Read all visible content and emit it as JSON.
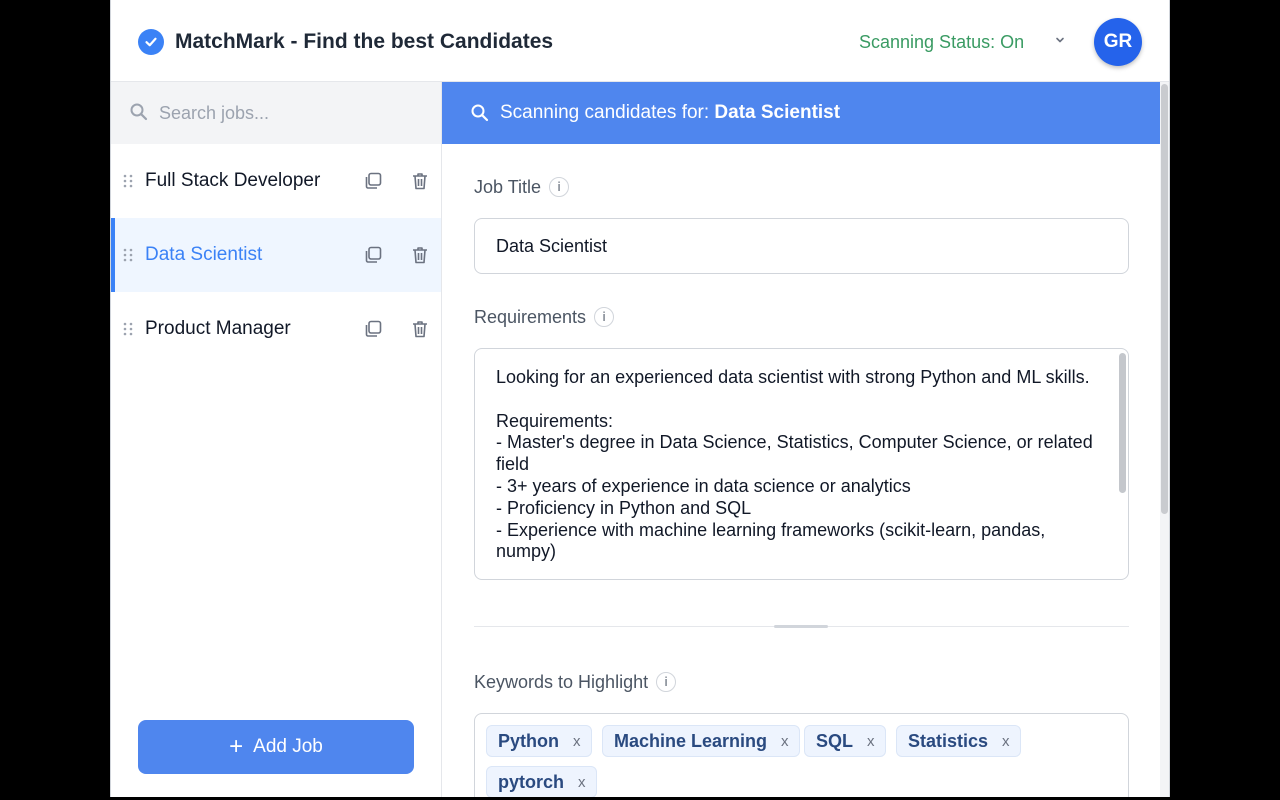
{
  "header": {
    "title": "MatchMark - Find the best Candidates",
    "status": "Scanning Status: On",
    "avatar_initials": "GR",
    "brand_color": "#3b82f6",
    "status_color": "#3a9b63"
  },
  "sidebar": {
    "search_placeholder": "Search jobs...",
    "jobs": [
      {
        "label": "Full Stack Developer",
        "active": false
      },
      {
        "label": "Data Scientist",
        "active": true
      },
      {
        "label": "Product Manager",
        "active": false
      }
    ],
    "add_button_label": "Add Job"
  },
  "main": {
    "banner_prefix": "Scanning candidates for:",
    "banner_job": "Data Scientist",
    "job_title_label": "Job Title",
    "job_title_value": "Data Scientist",
    "requirements_label": "Requirements",
    "requirements_text": "Looking for an experienced data scientist with strong Python and ML skills.\n\nRequirements:\n- Master's degree in Data Science, Statistics, Computer Science, or related field\n- 3+ years of experience in data science or analytics\n- Proficiency in Python and SQL\n- Experience with machine learning frameworks (scikit-learn, pandas, numpy)",
    "keywords_label": "Keywords to Highlight",
    "keywords": [
      "Python",
      "Machine Learning",
      "SQL",
      "Statistics",
      "pytorch"
    ],
    "info_glyph": "i",
    "remove_glyph": "x"
  }
}
